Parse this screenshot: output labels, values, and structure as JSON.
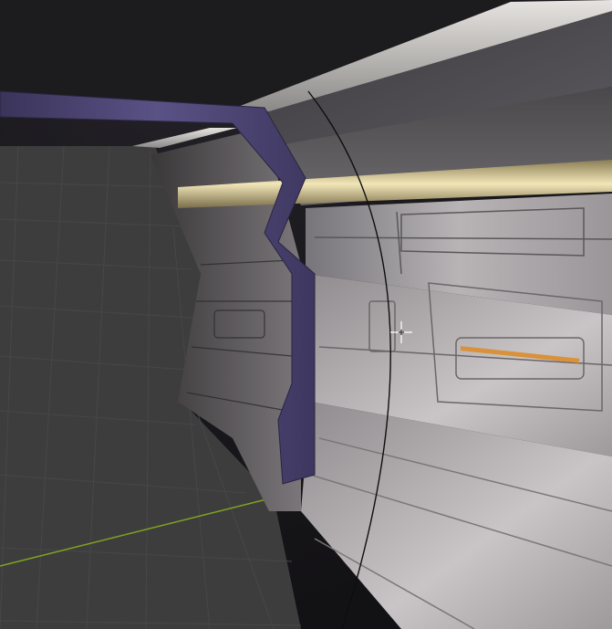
{
  "viewport": {
    "kind": "3d-viewport",
    "sky_color": "#1b1a1d",
    "grid_floor_color": "#3d3d3d",
    "grid_line_color": "#474747",
    "x_axis_color": "#7fa51f",
    "trim_color": "#4a4270",
    "light_strip_color": "#e8d9a4"
  },
  "cursor": {
    "icon": "crosshair-3d-cursor-icon"
  }
}
